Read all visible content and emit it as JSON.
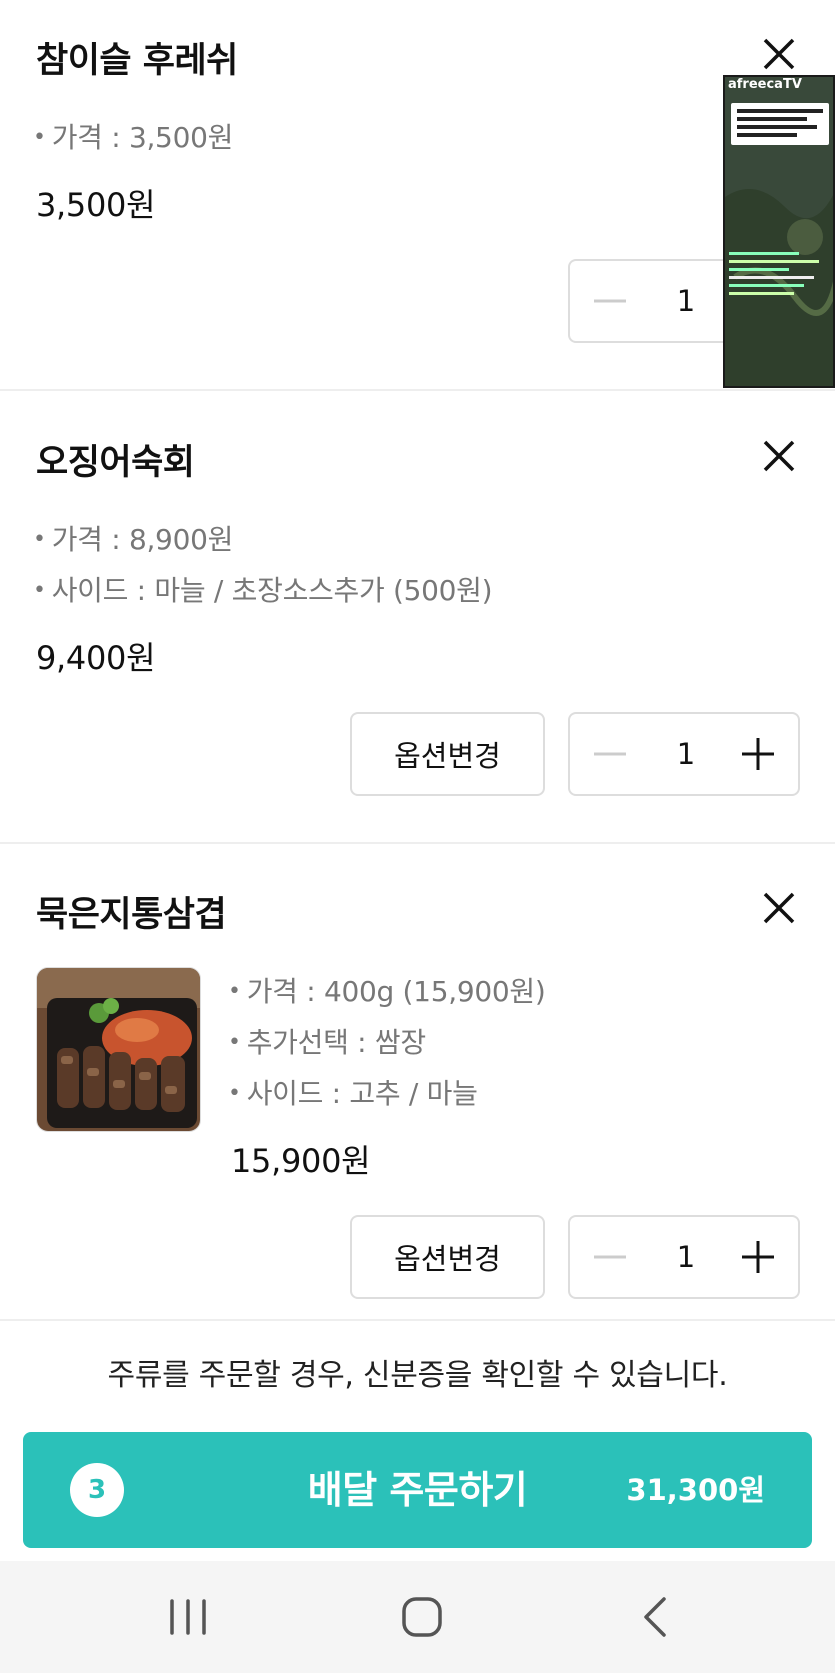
{
  "items": [
    {
      "name": "참이슬 후레쉬",
      "options": [
        "가격 : 3,500원"
      ],
      "price": "3,500원",
      "quantity": "1"
    },
    {
      "name": "오징어숙회",
      "options": [
        "가격 : 8,900원",
        "사이드 : 마늘 / 초장소스추가 (500원)"
      ],
      "price": "9,400원",
      "quantity": "1",
      "option_button": "옵션변경"
    },
    {
      "name": "묵은지통삼겹",
      "options": [
        "가격 : 400g (15,900원)",
        "추가선택 : 쌈장",
        "사이드 : 고추 / 마늘"
      ],
      "price": "15,900원",
      "quantity": "1",
      "option_button": "옵션변경"
    }
  ],
  "overlay": {
    "brand": "afreecaTV"
  },
  "notice": "주류를 주문할 경우, 신분증을 확인할 수 있습니다.",
  "order_button": {
    "count": "3",
    "label": "배달 주문하기",
    "total": "31,300원"
  },
  "colors": {
    "accent": "#2bc1b9",
    "divider": "#eeeeee",
    "muted_text": "#777777"
  },
  "icons": {
    "remove": "close-icon",
    "decrease": "minus-icon",
    "increase": "plus-icon"
  }
}
